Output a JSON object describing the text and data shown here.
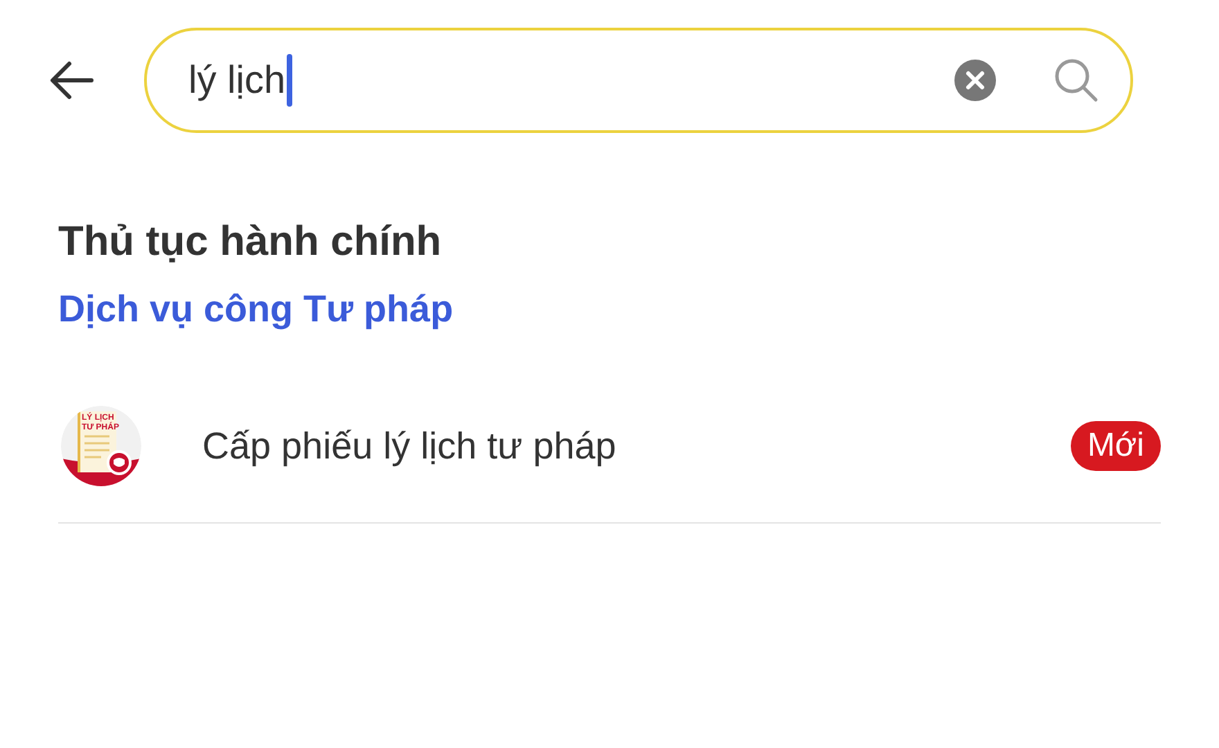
{
  "search": {
    "value": "lý lịch"
  },
  "section": {
    "title": "Thủ tục hành chính",
    "link": "Dịch vụ công Tư pháp"
  },
  "results": [
    {
      "icon_text": [
        "LÝ LỊCH",
        "TƯ PHÁP"
      ],
      "title": "Cấp phiếu lý lịch tư pháp",
      "badge": "Mới"
    }
  ]
}
